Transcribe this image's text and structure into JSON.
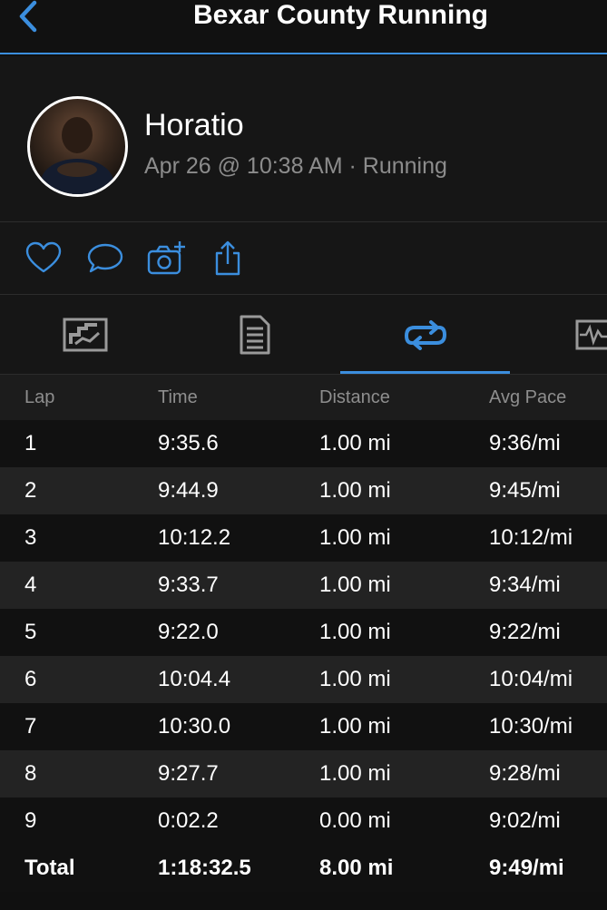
{
  "nav": {
    "title": "Bexar County Running",
    "back_icon": "chevron-left-icon"
  },
  "activity": {
    "user_name": "Horatio",
    "meta": "Apr 26 @ 10:38 AM · Running"
  },
  "actions": [
    "heart-icon",
    "comment-icon",
    "add-photo-icon",
    "share-icon"
  ],
  "tabs": [
    {
      "icon": "chart-overview-icon",
      "selected": false
    },
    {
      "icon": "details-list-icon",
      "selected": false
    },
    {
      "icon": "laps-loop-icon",
      "selected": true
    },
    {
      "icon": "graph-icon",
      "selected": false
    }
  ],
  "colors": {
    "accent": "#3b8ede",
    "background": "#101010",
    "muted_text": "#8c8c8c"
  },
  "laps": {
    "headers": [
      "Lap",
      "Time",
      "Distance",
      "Avg Pace"
    ],
    "rows": [
      [
        "1",
        "9:35.6",
        "1.00 mi",
        "9:36/mi"
      ],
      [
        "2",
        "9:44.9",
        "1.00 mi",
        "9:45/mi"
      ],
      [
        "3",
        "10:12.2",
        "1.00 mi",
        "10:12/mi"
      ],
      [
        "4",
        "9:33.7",
        "1.00 mi",
        "9:34/mi"
      ],
      [
        "5",
        "9:22.0",
        "1.00 mi",
        "9:22/mi"
      ],
      [
        "6",
        "10:04.4",
        "1.00 mi",
        "10:04/mi"
      ],
      [
        "7",
        "10:30.0",
        "1.00 mi",
        "10:30/mi"
      ],
      [
        "8",
        "9:27.7",
        "1.00 mi",
        "9:28/mi"
      ],
      [
        "9",
        "0:02.2",
        "0.00 mi",
        "9:02/mi"
      ]
    ],
    "total": [
      "Total",
      "1:18:32.5",
      "8.00 mi",
      "9:49/mi"
    ]
  }
}
